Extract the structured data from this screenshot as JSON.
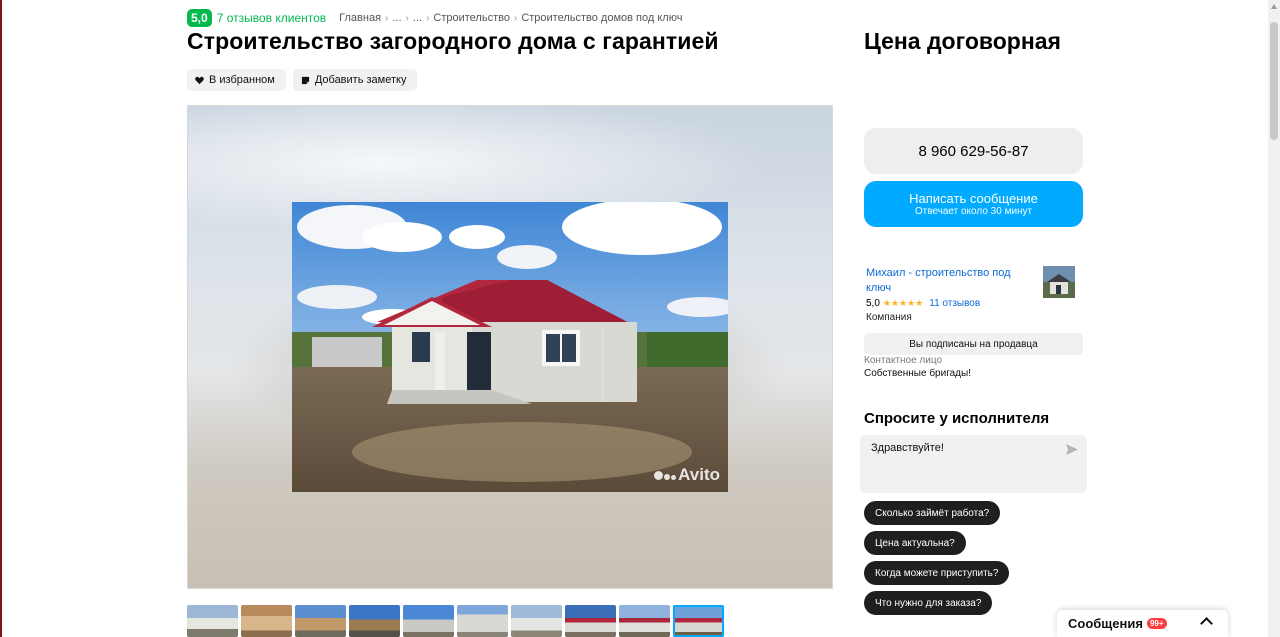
{
  "header": {
    "rating": "5,0",
    "reviews_link": "7 отзывов клиентов",
    "breadcrumb": [
      "Главная",
      "...",
      "...",
      "Строительство",
      "Строительство домов под ключ"
    ]
  },
  "title": "Строительство загородного дома с гарантией",
  "actions": {
    "favorite": "В избранном",
    "note": "Добавить заметку"
  },
  "gallery": {
    "watermark": "Avito",
    "thumbnail_count": 10,
    "active_thumbnail": 10
  },
  "price": "Цена договорная",
  "contact": {
    "phone": "8 960 629-56-87",
    "message_button": "Написать сообщение",
    "message_response": "Отвечает около 30 минут"
  },
  "seller": {
    "name": "Михаил - строительство под ключ",
    "rating": "5,0",
    "stars": "★★★★★",
    "reviews": "11 отзывов",
    "type": "Компания",
    "subscribed": "Вы подписаны на продавца",
    "contact_label": "Контактное лицо",
    "contact_value": "Собственные бригады!"
  },
  "ask": {
    "title": "Спросите у исполнителя",
    "input_value": "Здравствуйте!",
    "quick_questions": [
      "Сколько займёт работа?",
      "Цена актуальна?",
      "Когда можете приступить?",
      "Что нужно для заказа?"
    ]
  },
  "messages": {
    "label": "Сообщения",
    "badge": "99+"
  },
  "colors": {
    "accent_blue": "#00aaff",
    "rating_green": "#04b94e",
    "link_blue": "#0a6ad8",
    "star": "#ffb021"
  }
}
